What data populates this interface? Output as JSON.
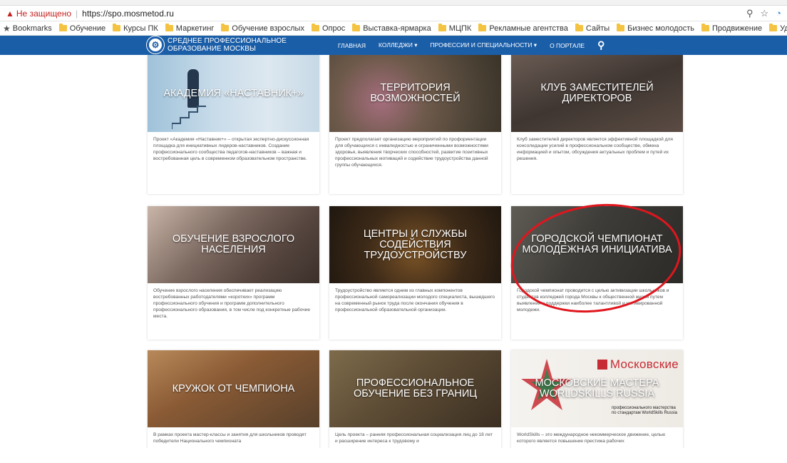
{
  "browser": {
    "insecure_label": "Не защищено",
    "url": "https://spo.mosmetod.ru",
    "zoom_icon": "zoom-icon",
    "star_icon": "star-icon",
    "bookmarks": [
      {
        "label": "Bookmarks"
      },
      {
        "label": "Обучение"
      },
      {
        "label": "Курсы ПК"
      },
      {
        "label": "Маркетинг"
      },
      {
        "label": "Обучение взрослых"
      },
      {
        "label": "Опрос"
      },
      {
        "label": "Выставка-ярмарка"
      },
      {
        "label": "МЦПК"
      },
      {
        "label": "Рекламные агентства"
      },
      {
        "label": "Сайты"
      },
      {
        "label": "Бизнес молодость"
      },
      {
        "label": "Продвижение"
      },
      {
        "label": "Удачные прим"
      }
    ]
  },
  "header": {
    "logo_line1": "Среднее профессиональное",
    "logo_line2": "образование Москвы",
    "nav": [
      {
        "label": "Главная"
      },
      {
        "label": "Колледжи ▾"
      },
      {
        "label": "Профессии и специальности ▾"
      },
      {
        "label": "О портале"
      }
    ],
    "colors": {
      "header_bg": "#1b5ea8",
      "highlight": "#e0161e"
    }
  },
  "cards": [
    {
      "title": "Академия «Наставник+»",
      "desc": "Проект «Академия «Наставник+» – открытая экспертно-дискуссионная площадка для инициативных лидеров-наставников. Создание профессионального сообщества педагогов-наставников – важная и востребованная цель в современном образовательном пространстве."
    },
    {
      "title": "Территория возможностей",
      "desc": "Проект предполагает организацию мероприятий по профориентации для обучающихся с инвалидностью и ограниченными возможностями здоровья, выявления творческих способностей, развитие позитивных профессиональных мотиваций и содействие трудоустройства данной группы обучающихся."
    },
    {
      "title": "Клуб заместителей директоров",
      "desc": "Клуб заместителей директоров является эффективной площадкой для консолидации усилий в профессиональном сообществе, обмена информацией и опытом, обсуждения актуальных проблем и путей их решения."
    },
    {
      "title": "Обучение взрослого населения",
      "desc": "Обучение взрослого населения обеспечивает реализацию востребованных работодателями «коротких» программ профессионального обучения и программ дополнительного профессионального образования, в том числе под конкретные рабочие места."
    },
    {
      "title": "Центры и службы содействия трудоустройству",
      "desc": "Трудоустройство является одним из главных компонентов профессиональной самореализации молодого специалиста, вышедшего на современный рынок труда после окончания обучения в профессиональной образовательной организации."
    },
    {
      "title": "Городской чемпионат Молодежная инициатива",
      "desc": "Городской чемпионат проводится с целью активизации школьников и студентов колледжей города Москвы к общественной жизни путем выявления и поддержки наиболее талантливой и мотивированной молодежи."
    },
    {
      "title": "Кружок от чемпиона",
      "desc": "В рамках проекта мастер-классы и занятия для школьников проводят победители Национального чемпионата"
    },
    {
      "title": "Профессиональное обучение без границ",
      "desc": "Цель проекта – ранняя профессиональная социализация лиц до 18 лет и расширение интереса к трудовому и"
    },
    {
      "title": "Московские мастера WorldSkills Russia",
      "desc": "WorldSkills – это международное некоммерческое движение, целью которого является повышение престижа рабочих",
      "brand": "Московские",
      "brand_sub1": "профессионального мастерства",
      "brand_sub2": "по стандартам WorldSkills Russia"
    }
  ]
}
